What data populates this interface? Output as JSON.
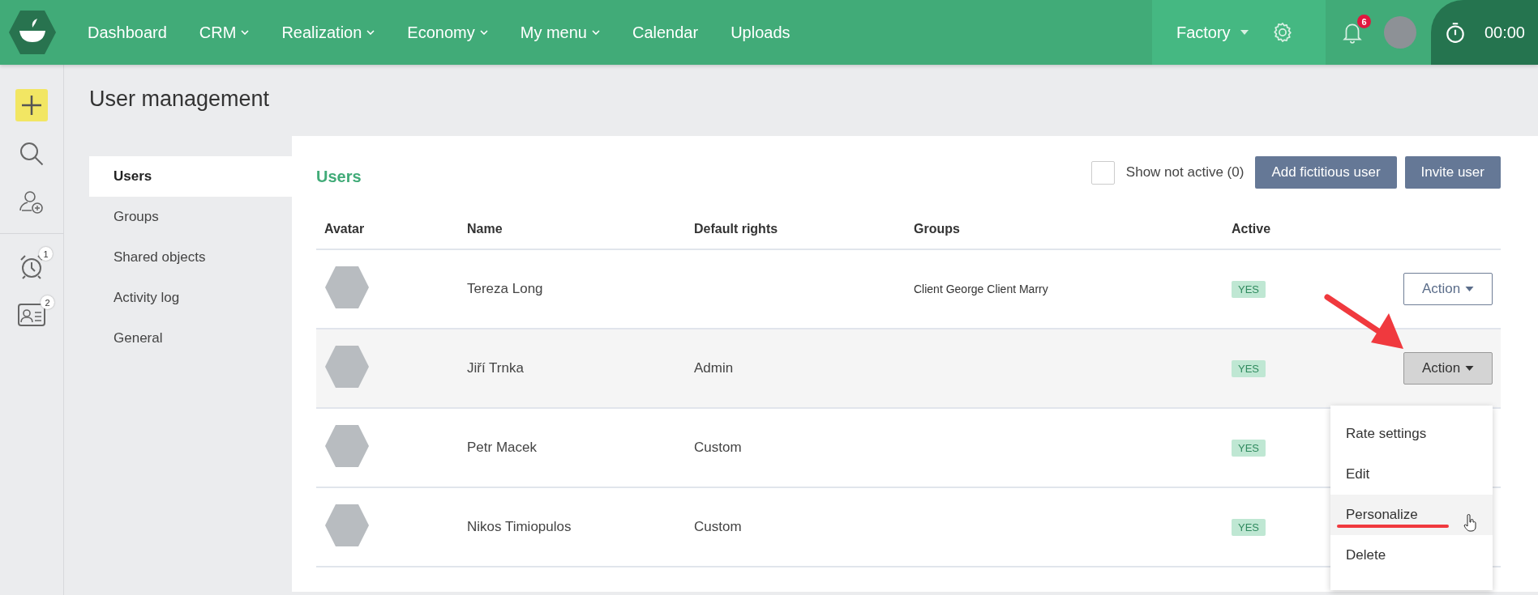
{
  "top_bar": {
    "nav": [
      {
        "label": "Dashboard",
        "dropdown": false
      },
      {
        "label": "CRM",
        "dropdown": true
      },
      {
        "label": "Realization",
        "dropdown": true
      },
      {
        "label": "Economy",
        "dropdown": true
      },
      {
        "label": "My menu",
        "dropdown": true
      },
      {
        "label": "Calendar",
        "dropdown": false
      },
      {
        "label": "Uploads",
        "dropdown": false
      }
    ],
    "workspace": "Factory",
    "notifications_count": "6",
    "timer": "00:00"
  },
  "rail": {
    "items": [
      {
        "kind": "add"
      },
      {
        "kind": "search"
      },
      {
        "kind": "add-user"
      },
      {
        "kind": "alarm",
        "badge": "1"
      },
      {
        "kind": "contact",
        "badge": "2"
      }
    ]
  },
  "page_title": "User management",
  "subnav": [
    {
      "label": "Users",
      "selected": true
    },
    {
      "label": "Groups",
      "selected": false
    },
    {
      "label": "Shared objects",
      "selected": false
    },
    {
      "label": "Activity log",
      "selected": false
    },
    {
      "label": "General",
      "selected": false
    }
  ],
  "panel": {
    "title": "Users",
    "show_not_active": {
      "label": "Show not active (0)",
      "checked": false
    },
    "buttons": [
      "Add fictitious user",
      "Invite user"
    ]
  },
  "table": {
    "columns": [
      "Avatar",
      "Name",
      "Default rights",
      "Groups",
      "Active"
    ],
    "rows": [
      {
        "name": "Tereza Long",
        "groups": "Client George Client Marry",
        "active": "YES",
        "action": "Action",
        "menu_open": false
      },
      {
        "name": "Jiří Trnka",
        "rights": "Admin",
        "active": "YES",
        "action": "Action",
        "menu_open": true
      },
      {
        "name": "Petr Macek",
        "rights": "Custom",
        "active": "YES",
        "menu_open": false
      },
      {
        "name": "Nikos Timiopulos",
        "rights": "Custom",
        "active": "YES",
        "menu_open": false
      }
    ]
  },
  "action_menu": {
    "items": [
      {
        "label": "Rate settings",
        "hovered": false
      },
      {
        "label": "Edit",
        "hovered": false
      },
      {
        "label": "Personalize",
        "hovered": true
      },
      {
        "label": "Delete",
        "hovered": false
      }
    ]
  }
}
